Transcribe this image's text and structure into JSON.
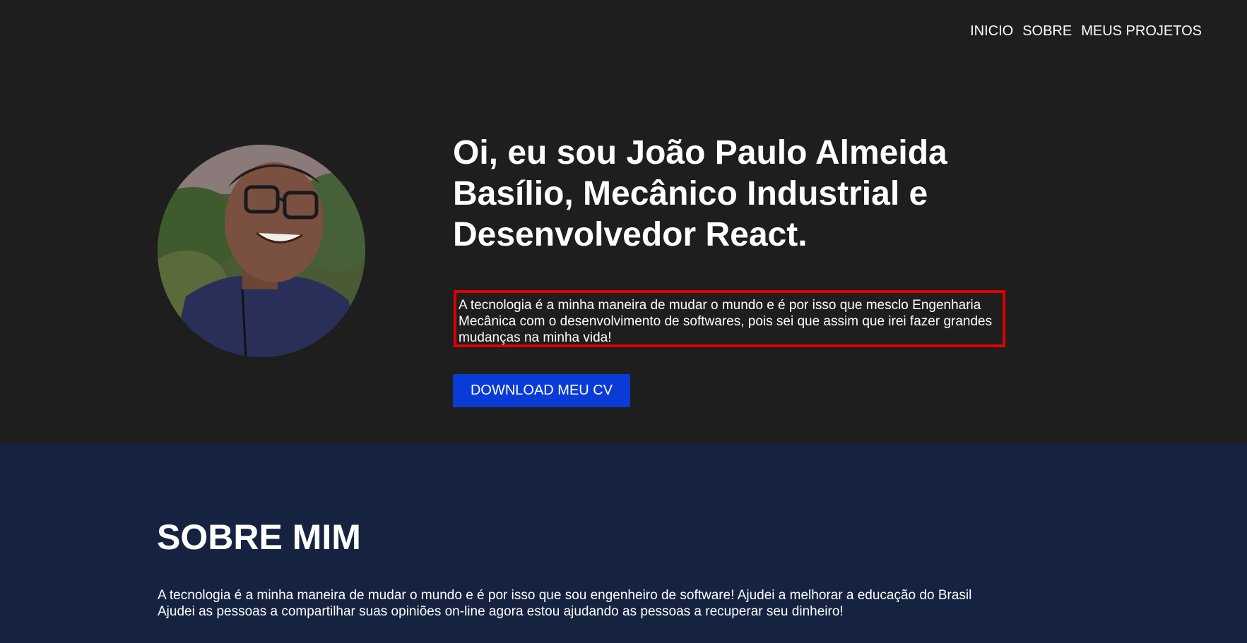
{
  "nav": {
    "items": [
      {
        "label": "INICIO"
      },
      {
        "label": "SOBRE"
      },
      {
        "label": "MEUS PROJETOS"
      }
    ]
  },
  "hero": {
    "headline": "Oi, eu sou João Paulo Almeida Basílio, Mecânico Industrial e Desenvolvedor React.",
    "tagline": "A tecnologia é a minha maneira de mudar o mundo e é por isso que mesclo Engenharia Mecânica com o desenvolvimento de softwares, pois sei que assim que irei fazer grandes mudanças na minha vida!",
    "cv_button": "DOWNLOAD MEU CV"
  },
  "about": {
    "title": "SOBRE MIM",
    "text": "A tecnologia é a minha maneira de mudar o mundo e é por isso que sou engenheiro de software! Ajudei a melhorar a educação do Brasil Ajudei as pessoas a compartilhar suas opiniões on-line agora estou ajudando as pessoas a recuperar seu dinheiro!"
  },
  "colors": {
    "hero_bg": "#1e1e1e",
    "about_bg": "#152240",
    "button_bg": "#0a3bd6",
    "highlight_border": "#e00000"
  }
}
